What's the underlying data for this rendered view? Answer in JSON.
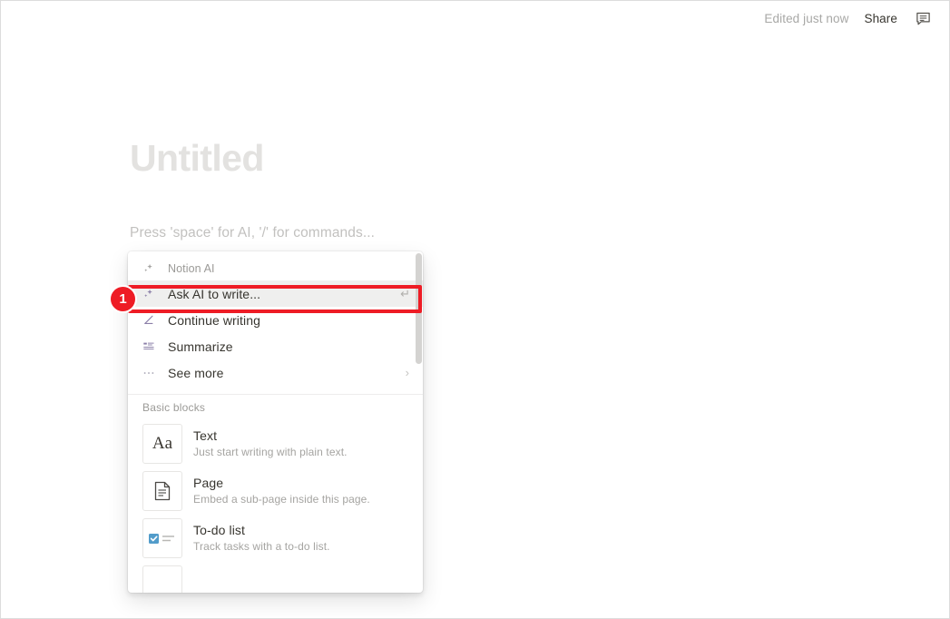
{
  "topbar": {
    "edited_status": "Edited just now",
    "share_label": "Share",
    "comment_icon": "comment-bubble-icon"
  },
  "document": {
    "title": "Untitled",
    "placeholder": "Press 'space' for AI, '/' for commands..."
  },
  "slash_menu": {
    "ai_section": {
      "label": "Notion AI",
      "header_icon": "sparkle-icon",
      "items": [
        {
          "label": "Ask AI to write...",
          "icon": "sparkle-icon",
          "hint": "↵",
          "selected": true
        },
        {
          "label": "Continue writing",
          "icon": "pen-icon",
          "hint": "",
          "selected": false
        },
        {
          "label": "Summarize",
          "icon": "summarize-icon",
          "hint": "",
          "selected": false
        },
        {
          "label": "See more",
          "icon": "ellipsis-icon",
          "hint": "›",
          "selected": false
        }
      ]
    },
    "blocks_section": {
      "label": "Basic blocks",
      "items": [
        {
          "title": "Text",
          "description": "Just start writing with plain text.",
          "icon": "text-aa-icon"
        },
        {
          "title": "Page",
          "description": "Embed a sub-page inside this page.",
          "icon": "page-document-icon"
        },
        {
          "title": "To-do list",
          "description": "Track tasks with a to-do list.",
          "icon": "checkbox-list-icon"
        }
      ]
    }
  },
  "annotation": {
    "badge_number": "1",
    "color": "#ee1c25"
  },
  "colors": {
    "accent_red": "#ee1c25",
    "ai_icon_purple": "#8b7fa8",
    "checkbox_blue": "#529cca",
    "text_primary": "#37352f",
    "text_muted": "#9b9a97"
  }
}
